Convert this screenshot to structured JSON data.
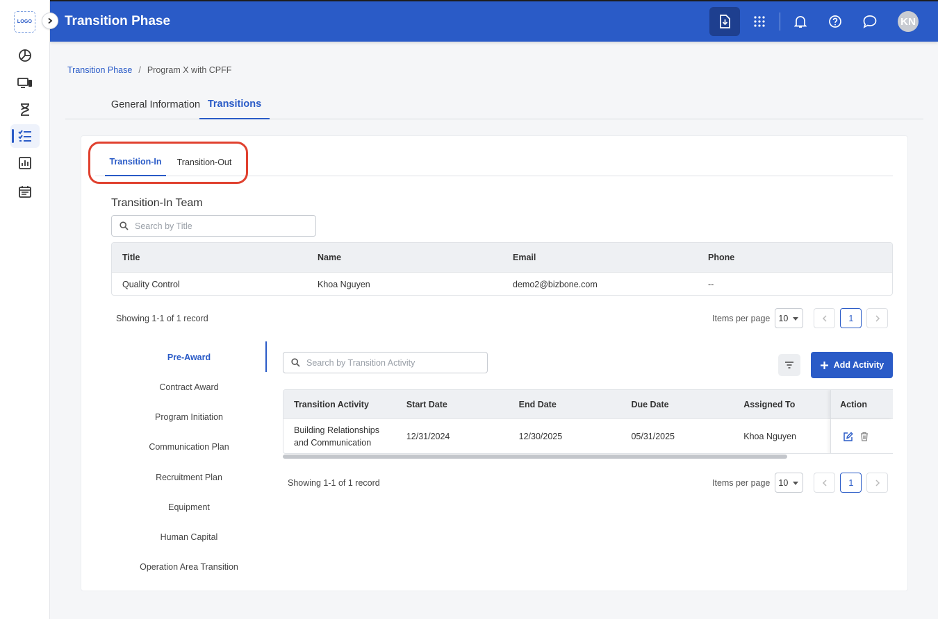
{
  "app": {
    "title": "Transition Phase",
    "logo": "LOGO",
    "user_initials": "KN"
  },
  "rail": {
    "icons": [
      "pie-chart-icon",
      "monitor-icon",
      "hourglass-icon",
      "checklist-icon",
      "bar-chart-icon",
      "calendar-icon"
    ],
    "active": "checklist-icon"
  },
  "topbar": {
    "icons": [
      "download-icon",
      "apps-grid-icon",
      "bell-icon",
      "help-icon",
      "chat-icon"
    ]
  },
  "breadcrumb": {
    "root": "Transition Phase",
    "separator": "/",
    "current": "Program X with CPFF"
  },
  "tabs": {
    "general": "General Information",
    "transitions": "Transitions",
    "active": "Transitions"
  },
  "subtabs": {
    "in": "Transition-In",
    "out": "Transition-Out",
    "active": "Transition-In"
  },
  "team": {
    "title": "Transition-In Team",
    "search_placeholder": "Search by Title",
    "columns": [
      "Title",
      "Name",
      "Email",
      "Phone"
    ],
    "rows": [
      [
        "Quality Control",
        "Khoa Nguyen",
        "demo2@bizbone.com",
        "--"
      ]
    ],
    "showing": "Showing 1-1 of 1 record",
    "items_per_page_label": "Items per page",
    "items_per_page": "10",
    "current_page": "1"
  },
  "phases": {
    "items": [
      "Pre-Award",
      "Contract Award",
      "Program Initiation",
      "Communication Plan",
      "Recruitment Plan",
      "Equipment",
      "Human Capital",
      "Operation Area Transition"
    ],
    "active": "Pre-Award"
  },
  "activities": {
    "search_placeholder": "Search by Transition Activity",
    "add_label": "Add Activity",
    "columns": [
      "Transition Activity",
      "Start Date",
      "End Date",
      "Due Date",
      "Assigned To",
      "Action"
    ],
    "rows": [
      {
        "activity_line1": "Building Relationships",
        "activity_line2": "and Communication",
        "start": "12/31/2024",
        "end": "12/30/2025",
        "due": "05/31/2025",
        "assigned": "Khoa Nguyen"
      }
    ],
    "showing": "Showing 1-1 of 1 record",
    "items_per_page_label": "Items per page",
    "items_per_page": "10",
    "current_page": "1"
  },
  "colors": {
    "primary": "#2a5bc7",
    "highlight": "#e0412f"
  }
}
